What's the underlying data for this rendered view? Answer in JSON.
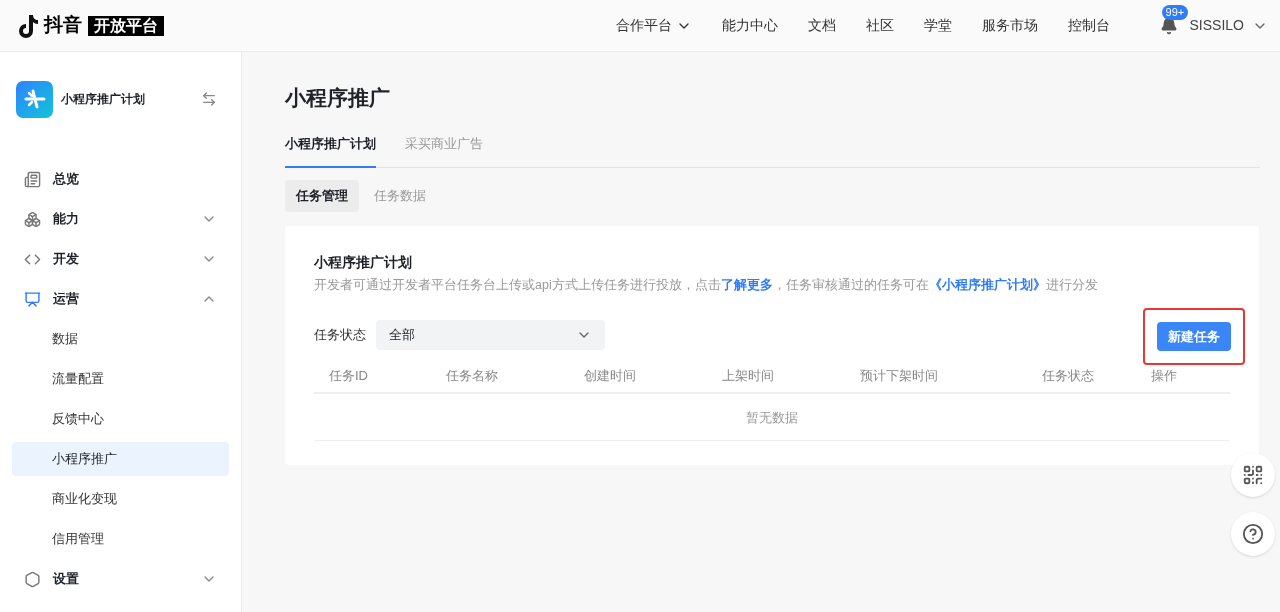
{
  "header": {
    "logo_text": "抖音",
    "logo_badge": "开放平台",
    "nav": [
      {
        "label": "合作平台",
        "dropdown": true
      },
      {
        "label": "能力中心",
        "dropdown": false
      },
      {
        "label": "文档",
        "dropdown": false
      },
      {
        "label": "社区",
        "dropdown": false
      },
      {
        "label": "学堂",
        "dropdown": false
      },
      {
        "label": "服务市场",
        "dropdown": false
      },
      {
        "label": "控制台",
        "dropdown": false
      }
    ],
    "notification_badge": "99+",
    "user": "SISSILO"
  },
  "sidebar": {
    "app_name": "小程序推广计划",
    "items": [
      {
        "label": "总览",
        "selected": false
      },
      {
        "label": "能力",
        "selected": false,
        "expanded": false
      },
      {
        "label": "开发",
        "selected": false,
        "expanded": false
      },
      {
        "label": "运营",
        "selected": true,
        "expanded": true,
        "children": [
          {
            "label": "数据",
            "selected": false
          },
          {
            "label": "流量配置",
            "selected": false
          },
          {
            "label": "反馈中心",
            "selected": false
          },
          {
            "label": "小程序推广",
            "selected": true
          },
          {
            "label": "商业化变现",
            "selected": false
          },
          {
            "label": "信用管理",
            "selected": false
          }
        ]
      },
      {
        "label": "设置",
        "selected": false,
        "expanded": false
      }
    ]
  },
  "main": {
    "title": "小程序推广",
    "tabs": [
      {
        "label": "小程序推广计划",
        "selected": true
      },
      {
        "label": "采买商业广告",
        "selected": false
      }
    ],
    "subtabs": [
      {
        "label": "任务管理",
        "selected": true
      },
      {
        "label": "任务数据",
        "selected": false
      }
    ],
    "card": {
      "title": "小程序推广计划",
      "description": [
        {
          "kind": "text",
          "text": "开发者可通过开发者平台任务台上传或api方式上传任务进行投放，点击"
        },
        {
          "kind": "link",
          "text": "了解更多"
        },
        {
          "kind": "text",
          "text": "，任务审核通过的任务可在"
        },
        {
          "kind": "link",
          "text": "《小程序推广计划》"
        },
        {
          "kind": "text",
          "text": "进行分发"
        }
      ],
      "filter_label": "任务状态",
      "filter_value": "全部",
      "new_button": {
        "label": "新建任务",
        "highlighted": true
      },
      "table": {
        "columns": [
          "任务ID",
          "任务名称",
          "创建时间",
          "上架时间",
          "预计下架时间",
          "任务状态",
          "操作"
        ],
        "empty_text": "暂无数据"
      }
    }
  }
}
